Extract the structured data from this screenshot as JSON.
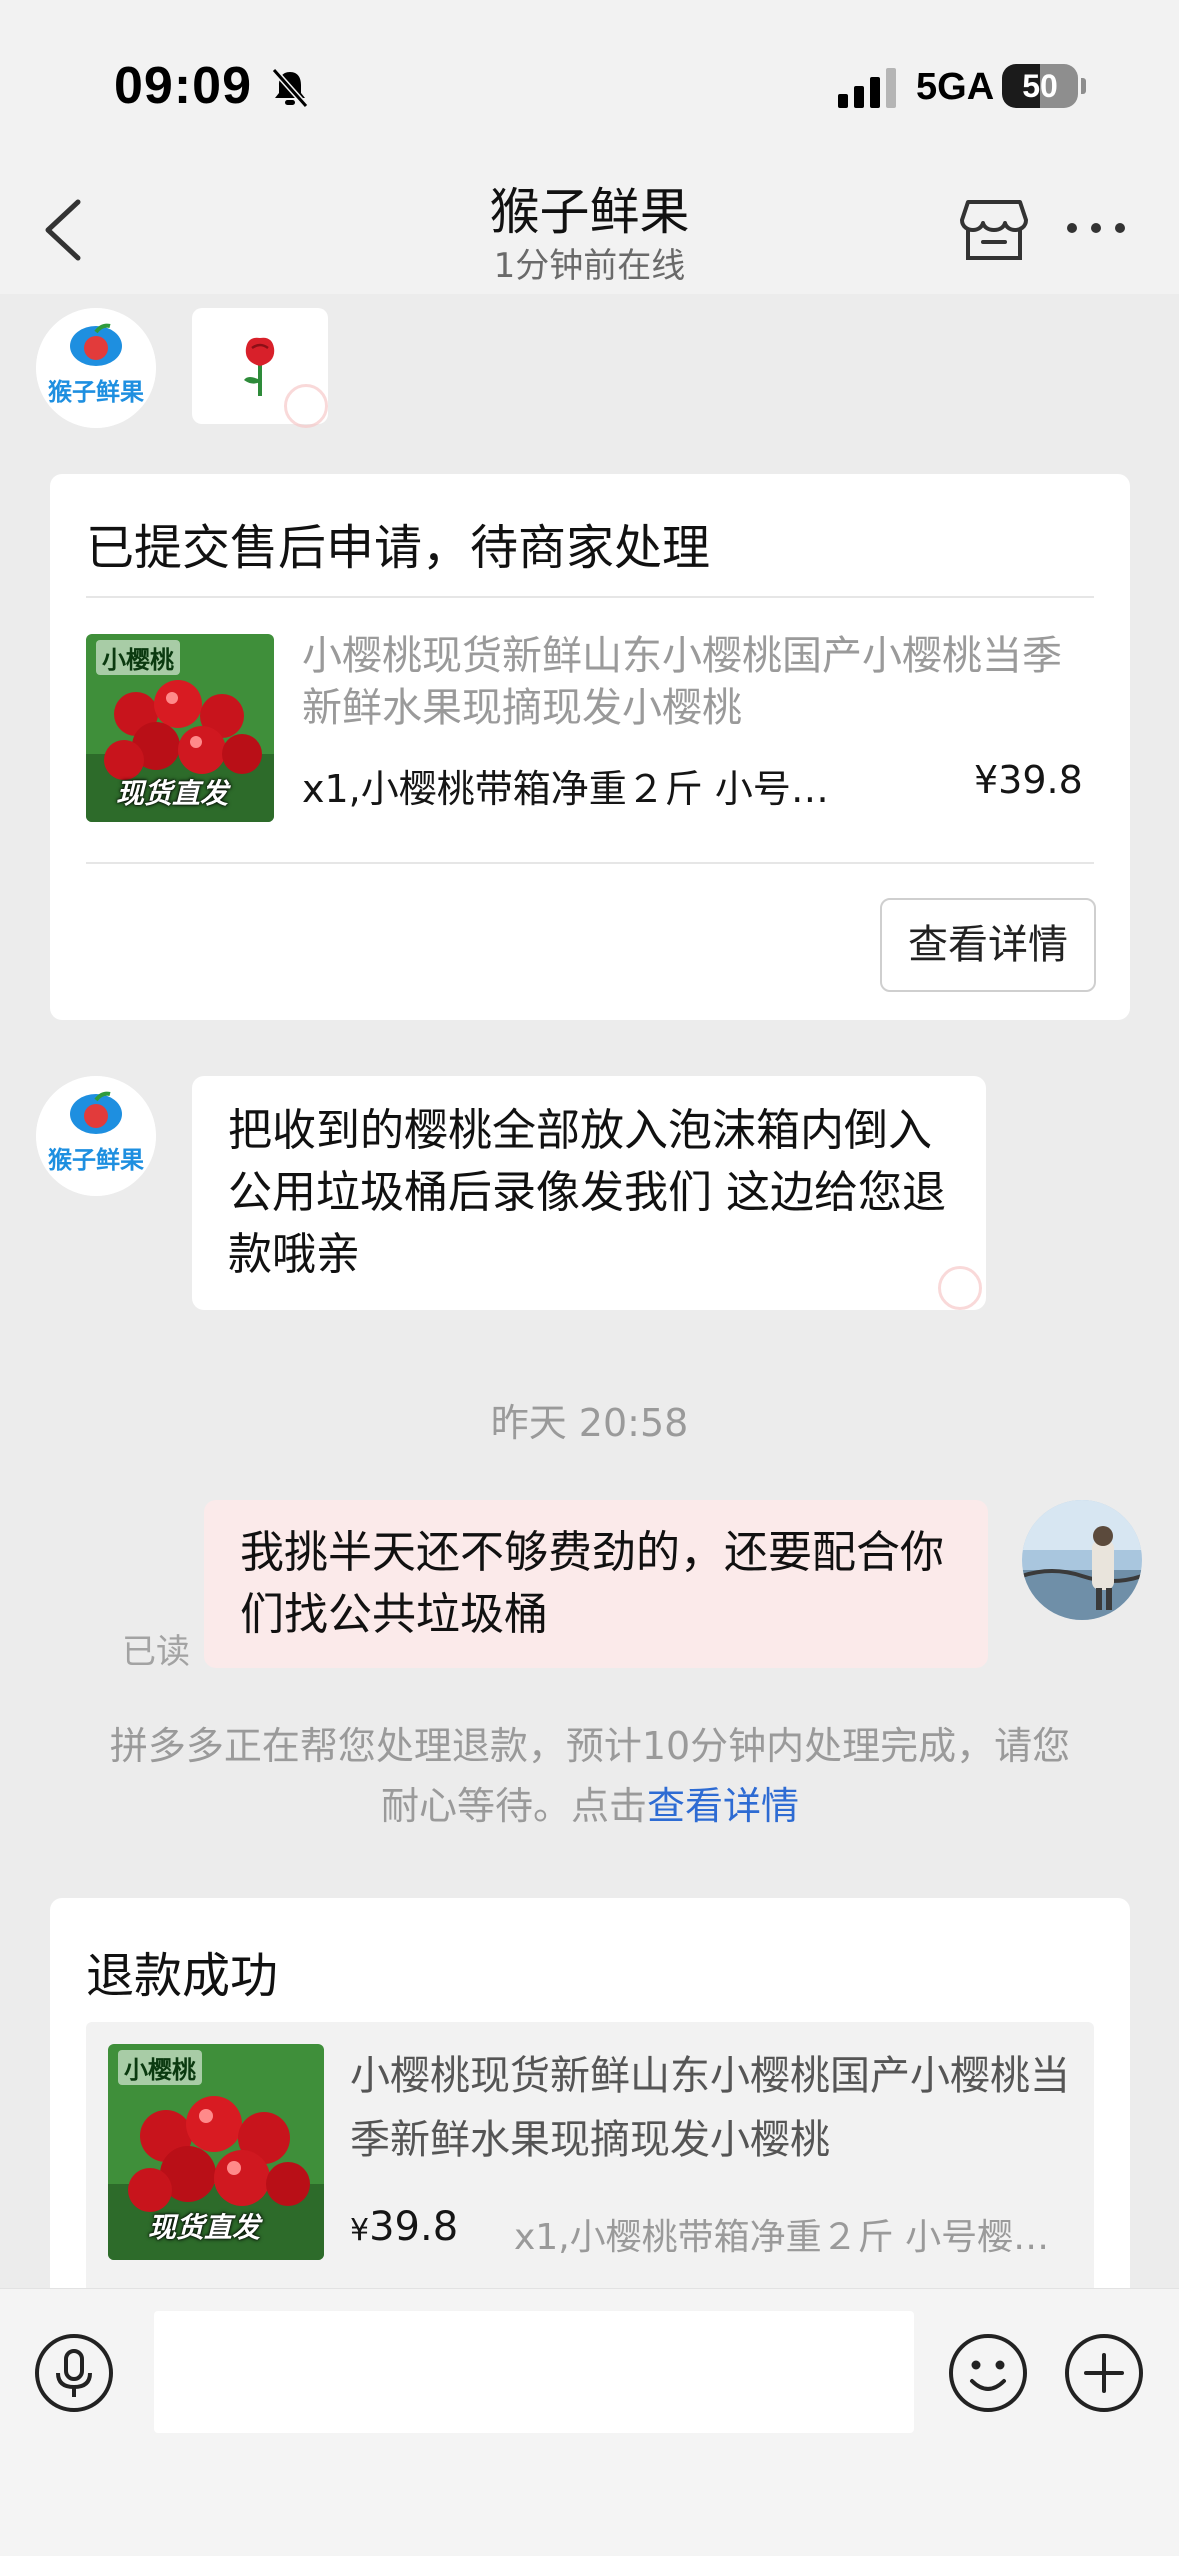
{
  "status_bar": {
    "time": "09:09",
    "network": "5GA",
    "battery_level": "50",
    "battery_fraction": 0.5
  },
  "nav": {
    "title": "猴子鲜果",
    "subtitle": "1分钟前在线"
  },
  "shop": {
    "avatar_text": "猴子鲜果"
  },
  "messages": {
    "rose": "🌹",
    "after_sale_card": {
      "title": "已提交售后申请，待商家处理",
      "product_title": "小樱桃现货新鲜山东小樱桃国产小樱桃当季新鲜水果现摘现发小樱桃",
      "spec": "x1,小樱桃带箱净重２斤 小号…",
      "price": "¥39.8",
      "button": "查看详情",
      "thumb_tag": "小樱桃",
      "thumb_badge": "现货直发"
    },
    "shop_reply": "把收到的樱桃全部放入泡沫箱内倒入公用垃圾桶后录像发我们 这边给您退款哦亲",
    "timestamp": "昨天 20:58",
    "user_message": "我挑半天还不够费劲的，还要配合你们找公共垃圾桶",
    "read_status": "已读",
    "system_note_text": "拼多多正在帮您处理退款，预计10分钟内处理完成，请您耐心等待。点击",
    "system_note_link": "查看详情",
    "refund_card": {
      "title": "退款成功",
      "product_title": "小樱桃现货新鲜山东小樱桃国产小樱桃当季新鲜水果现摘现发小樱桃",
      "price_symbol": "¥",
      "price": "39.8",
      "spec": "x1,小樱桃带箱净重２斤 小号樱…",
      "thumb_tag": "小樱桃",
      "thumb_badge": "现货直发"
    }
  },
  "input": {
    "placeholder": ""
  },
  "colors": {
    "background": "#ececec",
    "user_bubble": "#fbeaea",
    "link": "#2d6bd3",
    "shop_logo_blue": "#1e8fe0"
  }
}
